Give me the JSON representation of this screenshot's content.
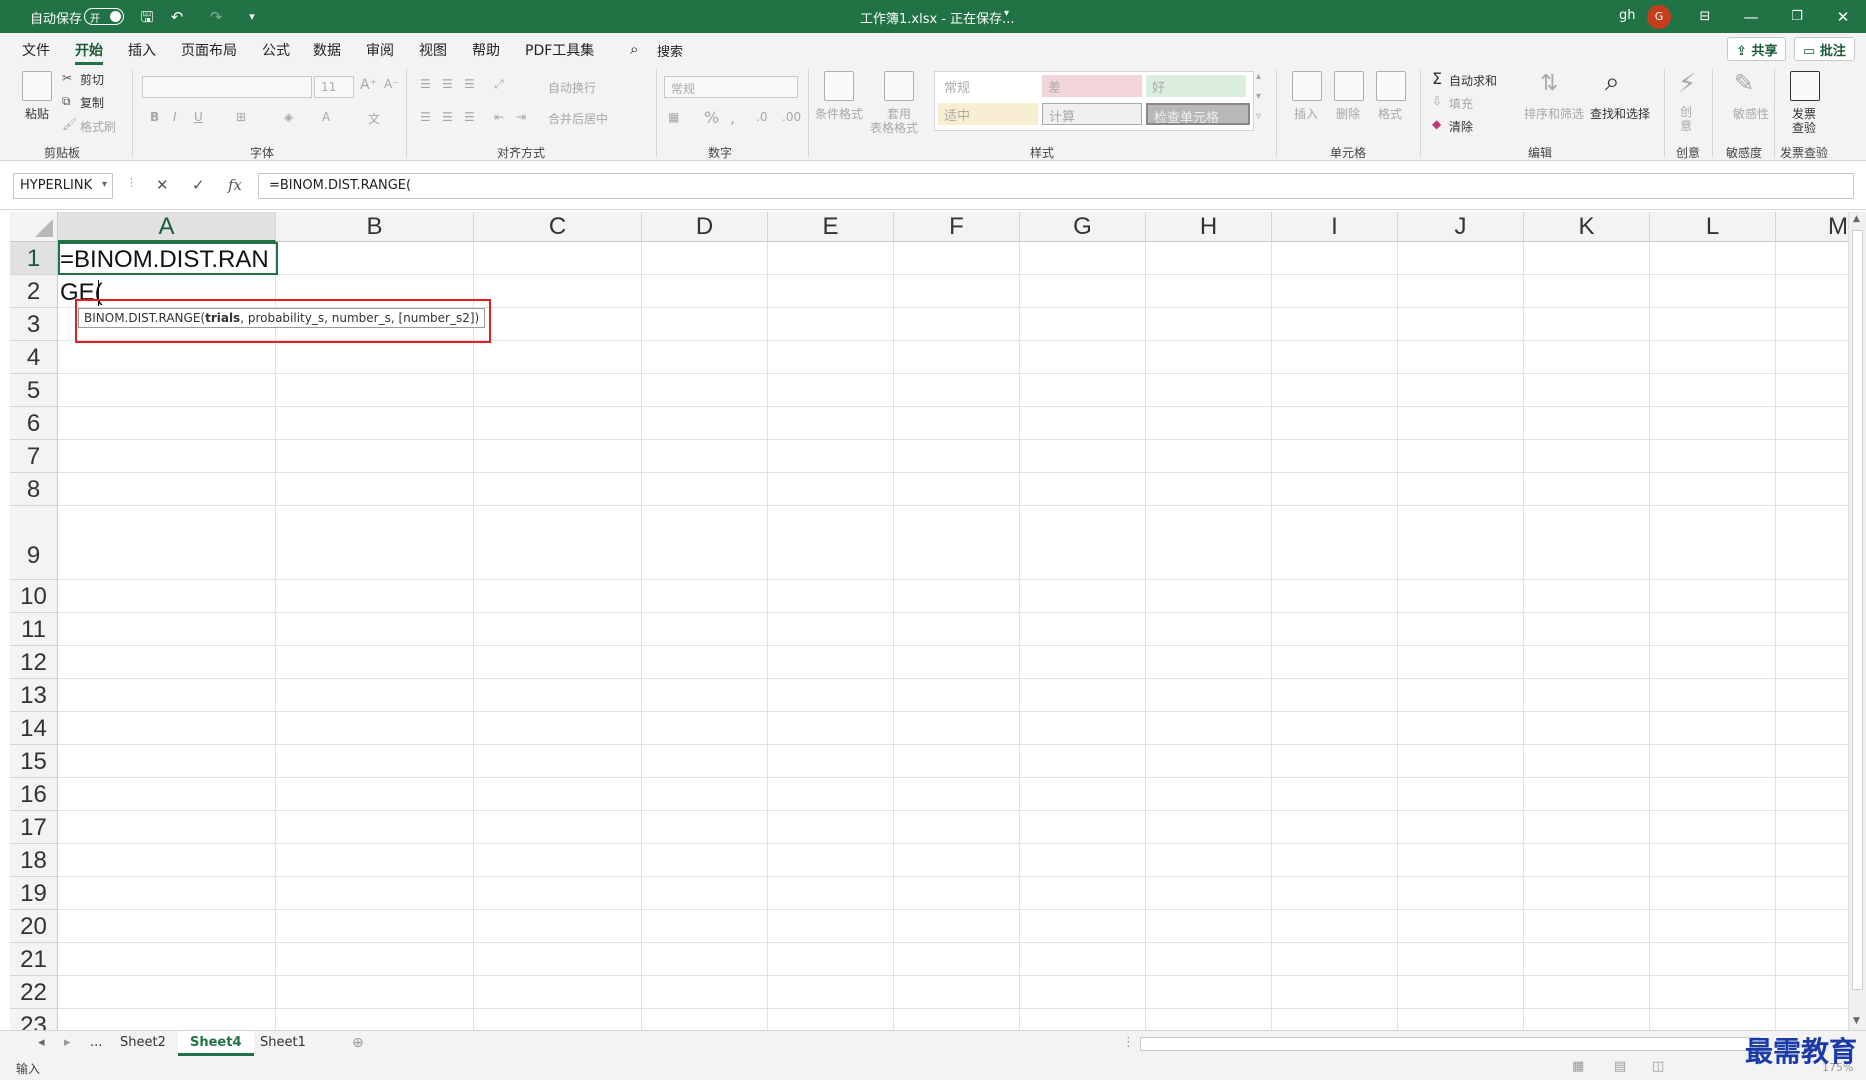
{
  "titlebar": {
    "autosave_label": "自动保存",
    "autosave_state": "开",
    "title": "工作簿1.xlsx - 正在保存...",
    "user_initials": "gh",
    "avatar_letter": "G",
    "accent_color": "#217346"
  },
  "menu": {
    "tabs": [
      "文件",
      "开始",
      "插入",
      "页面布局",
      "公式",
      "数据",
      "审阅",
      "视图",
      "帮助",
      "PDF工具集"
    ],
    "active_tab": "开始",
    "search_label": "搜索",
    "share_label": "共享",
    "comments_label": "批注"
  },
  "ribbon": {
    "clipboard": {
      "paste": "粘贴",
      "cut": "剪切",
      "copy": "复制",
      "format_painter": "格式刷",
      "label": "剪贴板"
    },
    "font": {
      "font_size": "11",
      "label": "字体"
    },
    "alignment": {
      "wrap": "自动换行",
      "merge": "合并后居中",
      "label": "对齐方式"
    },
    "number": {
      "format": "常规",
      "label": "数字"
    },
    "styles": {
      "conditional": "条件格式",
      "table_format_1": "套用",
      "table_format_2": "表格格式",
      "cells": [
        "常规",
        "差",
        "好",
        "适中",
        "计算",
        "检查单元格"
      ],
      "label": "样式"
    },
    "cells": {
      "insert": "插入",
      "delete": "删除",
      "format": "格式",
      "label": "单元格"
    },
    "editing": {
      "autosum": "自动求和",
      "fill": "填充",
      "clear": "清除",
      "sort": "排序和筛选",
      "find": "查找和选择",
      "label": "编辑"
    },
    "creative": {
      "btn": "创意",
      "label": "创意"
    },
    "sensitivity": {
      "btn": "敏感性",
      "label": "敏感度"
    },
    "invoice": {
      "btn_1": "发票",
      "btn_2": "查验",
      "label": "发票查验"
    }
  },
  "formula_bar": {
    "name_box": "HYPERLINK",
    "cancel": "✕",
    "confirm": "✓",
    "fx": "fx",
    "formula": "=BINOM.DIST.RANGE("
  },
  "grid": {
    "columns": [
      "A",
      "B",
      "C",
      "D",
      "E",
      "F",
      "G",
      "H",
      "I",
      "J",
      "K",
      "L",
      "M"
    ],
    "rows": [
      "1",
      "2",
      "3",
      "4",
      "5",
      "6",
      "7",
      "8",
      "9",
      "10",
      "11",
      "12",
      "13",
      "14",
      "15",
      "16",
      "17",
      "18",
      "19",
      "20",
      "21",
      "22",
      "23"
    ],
    "cell_a1_line1": "=BINOM.DIST.RAN",
    "cell_a1_line2": "GE(",
    "tooltip_fn": "BINOM.DIST.RANGE(",
    "tooltip_arg_bold": "trials",
    "tooltip_rest": ", probability_s, number_s, [number_s2])"
  },
  "sheets": {
    "more": "...",
    "tabs": [
      "Sheet2",
      "Sheet4",
      "Sheet1"
    ],
    "active": "Sheet4"
  },
  "status": {
    "mode": "输入",
    "zoom": "175%"
  },
  "watermark": "最需教育"
}
